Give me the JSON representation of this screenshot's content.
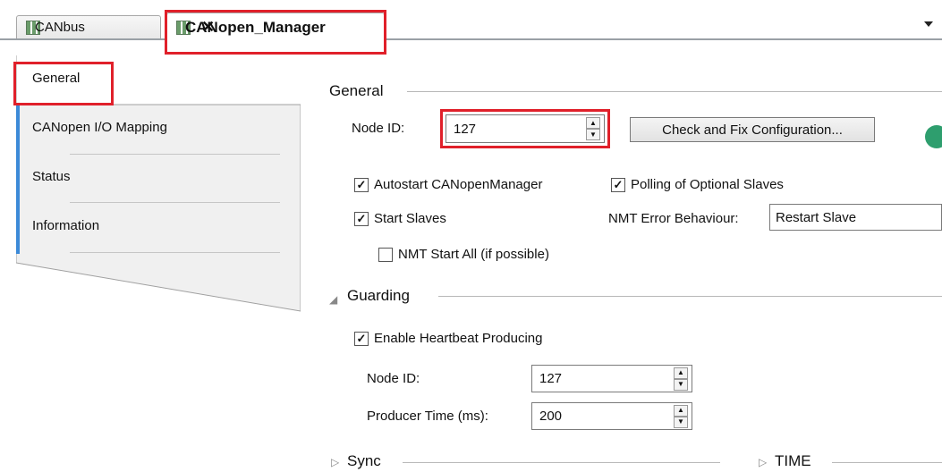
{
  "tabs": [
    {
      "label": "CANbus",
      "icon": "device-icon"
    },
    {
      "label": "CANopen_Manager",
      "icon": "device-icon",
      "close": "✕"
    }
  ],
  "nav": {
    "items": [
      "General",
      "CANopen I/O Mapping",
      "Status",
      "Information"
    ]
  },
  "general": {
    "title": "General",
    "node_id_label": "Node ID:",
    "node_id_value": "127",
    "check_fix_button": "Check and Fix Configuration...",
    "autostart_label": "Autostart CANopenManager",
    "polling_label": "Polling of Optional Slaves",
    "start_slaves_label": "Start Slaves",
    "nmt_start_all_label": "NMT Start All (if possible)",
    "nmt_error_label": "NMT Error Behaviour:",
    "nmt_error_value": "Restart Slave"
  },
  "guarding": {
    "title": "Guarding",
    "heartbeat_label": "Enable Heartbeat Producing",
    "node_id_label": "Node ID:",
    "node_id_value": "127",
    "producer_time_label": "Producer Time (ms):",
    "producer_time_value": "200"
  },
  "sync": {
    "title": "Sync"
  },
  "time": {
    "title": "TIME"
  },
  "checks": {
    "autostart": true,
    "polling": true,
    "start_slaves": true,
    "nmt_start_all": false,
    "heartbeat": true
  },
  "colors": {
    "highlight": "#e0202a",
    "nav_accent": "#3c8ad8",
    "nav_bg": "#f0f0f0"
  }
}
